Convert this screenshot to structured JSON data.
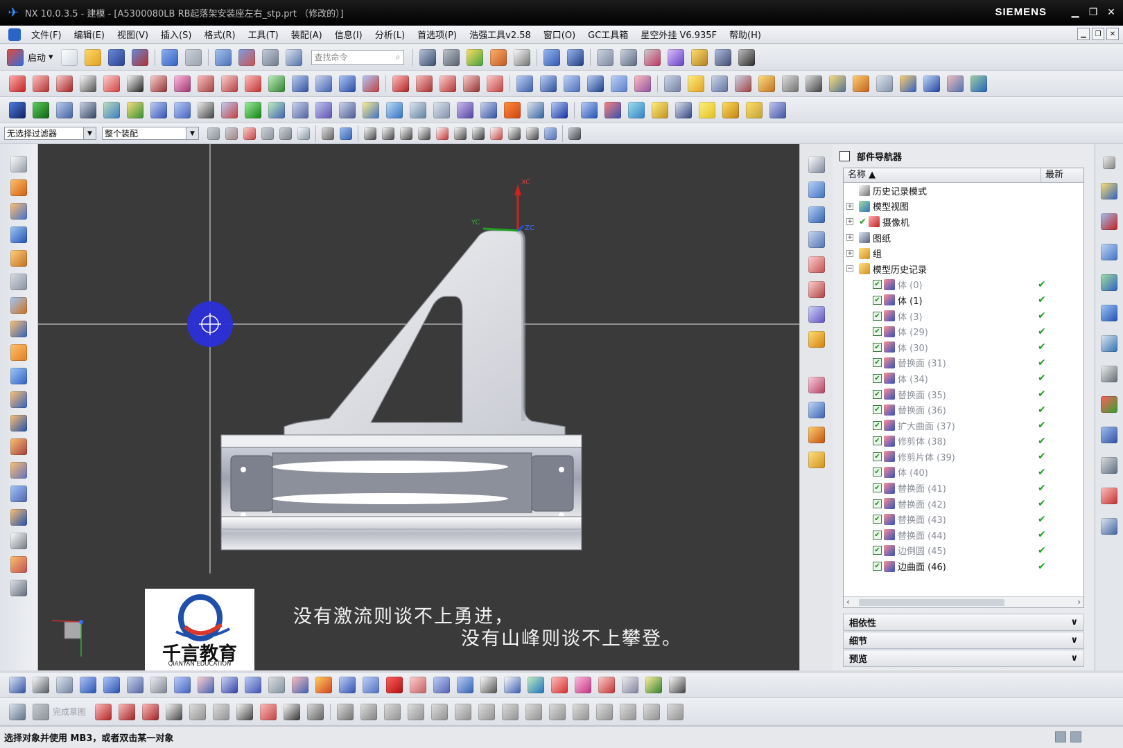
{
  "window": {
    "title": "NX 10.0.3.5 - 建模 - [A5300080LB RB起落架安装座左右_stp.prt （修改的）]",
    "brand": "SIEMENS",
    "controls": [
      "▁",
      "❐",
      "✕"
    ]
  },
  "menu": {
    "items": [
      "文件(F)",
      "编辑(E)",
      "视图(V)",
      "插入(S)",
      "格式(R)",
      "工具(T)",
      "装配(A)",
      "信息(I)",
      "分析(L)",
      "首选项(P)",
      "浩强工具v2.58",
      "窗口(O)",
      "GC工具箱",
      "星空外挂 V6.935F",
      "帮助(H)"
    ]
  },
  "toolbar": {
    "start_label": "启动",
    "search_placeholder": "查找命令"
  },
  "selection_bar": {
    "filter_value": "无选择过滤器",
    "scope_value": "整个装配"
  },
  "viewport": {
    "triad_labels": [
      "XC",
      "YC",
      "ZC"
    ],
    "watermark_brand": "千言教育",
    "watermark_sub": "QIANYAN EDUCATION",
    "caption_line1": "没有激流则谈不上勇进，",
    "caption_line2": "没有山峰则谈不上攀登。"
  },
  "navigator": {
    "title": "部件导航器",
    "col_name": "名称",
    "col_latest": "最新",
    "top_nodes": [
      {
        "label": "历史记录模式",
        "icon": "clock-icon"
      },
      {
        "label": "模型视图",
        "icon": "model-views-icon"
      },
      {
        "label": "摄像机",
        "icon": "camera-icon"
      },
      {
        "label": "图纸",
        "icon": "drawing-icon"
      },
      {
        "label": "组",
        "icon": "folder-icon"
      },
      {
        "label": "模型历史记录",
        "icon": "folder-open-icon"
      }
    ],
    "features": [
      {
        "label": "体 (0)",
        "dim": true
      },
      {
        "label": "体 (1)",
        "dim": false
      },
      {
        "label": "体 (3)",
        "dim": true
      },
      {
        "label": "体 (29)",
        "dim": true
      },
      {
        "label": "体 (30)",
        "dim": true
      },
      {
        "label": "替换面 (31)",
        "dim": true
      },
      {
        "label": "体 (34)",
        "dim": true
      },
      {
        "label": "替换面 (35)",
        "dim": true
      },
      {
        "label": "替换面 (36)",
        "dim": true
      },
      {
        "label": "扩大曲面 (37)",
        "dim": true
      },
      {
        "label": "修剪体 (38)",
        "dim": true
      },
      {
        "label": "修剪片体 (39)",
        "dim": true
      },
      {
        "label": "体 (40)",
        "dim": true
      },
      {
        "label": "替换面 (41)",
        "dim": true
      },
      {
        "label": "替换面 (42)",
        "dim": true
      },
      {
        "label": "替换面 (43)",
        "dim": true
      },
      {
        "label": "替换面 (44)",
        "dim": true
      },
      {
        "label": "边倒圆 (45)",
        "dim": true
      },
      {
        "label": "边曲面 (46)",
        "dim": false
      }
    ],
    "latest_mark": "✔",
    "sections": [
      "相依性",
      "细节",
      "预览"
    ]
  },
  "statusbar": {
    "message": "选择对象并使用 MB3，或者双击某一对象"
  },
  "bottom_toolbar": {
    "sketch_label": "完成草图"
  }
}
